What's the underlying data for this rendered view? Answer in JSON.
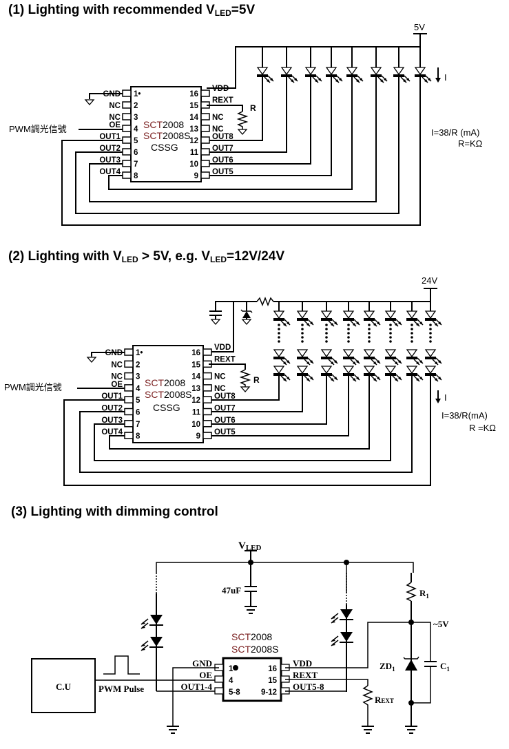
{
  "sections": [
    {
      "title_prefix": "(1) Lighting with recommended V",
      "title_sub": "LED",
      "title_suffix": "=5V",
      "supply_label": "5V",
      "current_label": "I",
      "formula_line1": "I=38/R (mA)",
      "formula_line2": "R=KΩ",
      "pwm_label": "PWM調光信號",
      "resistor_label": "R",
      "chip": {
        "line1_brand": "SCT",
        "line1_num": "2008",
        "line2_brand": "SCT",
        "line2_num": "2008S",
        "line3": "CSSG"
      },
      "left_pins": [
        {
          "name": "GND",
          "num": "1•"
        },
        {
          "name": "NC",
          "num": "2"
        },
        {
          "name": "NC",
          "num": "3"
        },
        {
          "name": "OE",
          "num": "4"
        },
        {
          "name": "OUT1",
          "num": "5"
        },
        {
          "name": "OUT2",
          "num": "6"
        },
        {
          "name": "OUT3",
          "num": "7"
        },
        {
          "name": "OUT4",
          "num": "8"
        }
      ],
      "right_pins": [
        {
          "name": "VDD",
          "num": "16"
        },
        {
          "name": "REXT",
          "num": "15"
        },
        {
          "name": "NC",
          "num": "14"
        },
        {
          "name": "NC",
          "num": "13"
        },
        {
          "name": "OUT8",
          "num": "12"
        },
        {
          "name": "OUT7",
          "num": "11"
        },
        {
          "name": "OUT6",
          "num": "10"
        },
        {
          "name": "OUT5",
          "num": "9"
        }
      ]
    },
    {
      "title_prefix": "(2) Lighting with V",
      "title_sub": "LED",
      "title_mid": " > 5V, e.g. V",
      "title_sub2": "LED",
      "title_suffix": "=12V/24V",
      "supply_label": "24V",
      "current_label": "I",
      "formula_line1": "I=38/R(mA)",
      "formula_line2": "R =KΩ",
      "pwm_label": "PWM調光信號",
      "resistor_label": "R"
    },
    {
      "title": "(3) Lighting with dimming control",
      "vled_label": "V",
      "vled_sub": "LED",
      "cap_label": "47uF",
      "cu_label": "C.U",
      "pwm_label": "PWM Pulse",
      "r1_label": "R",
      "r1_sub": "1",
      "zd_label": "ZD",
      "zd_sub": "1",
      "c1_label": "C",
      "c1_sub": "1",
      "v5_label": "~5V",
      "rext_label": "R",
      "rext_sub": "EXT",
      "chip": {
        "line1_brand": "SCT",
        "line1_num": "2008",
        "line2_brand": "SCT",
        "line2_num": "2008S"
      },
      "left_pins": [
        {
          "name": "GND",
          "num": "1"
        },
        {
          "name": "OE",
          "num": "4"
        },
        {
          "name": "OUT1-4",
          "num": "5-8"
        }
      ],
      "right_pins": [
        {
          "name": "VDD",
          "num": "16"
        },
        {
          "name": "REXT",
          "num": "15"
        },
        {
          "name": "OUT5-8",
          "num": "9-12"
        }
      ]
    }
  ],
  "colors": {
    "brand": "#7a1f1f",
    "line": "#000000"
  }
}
